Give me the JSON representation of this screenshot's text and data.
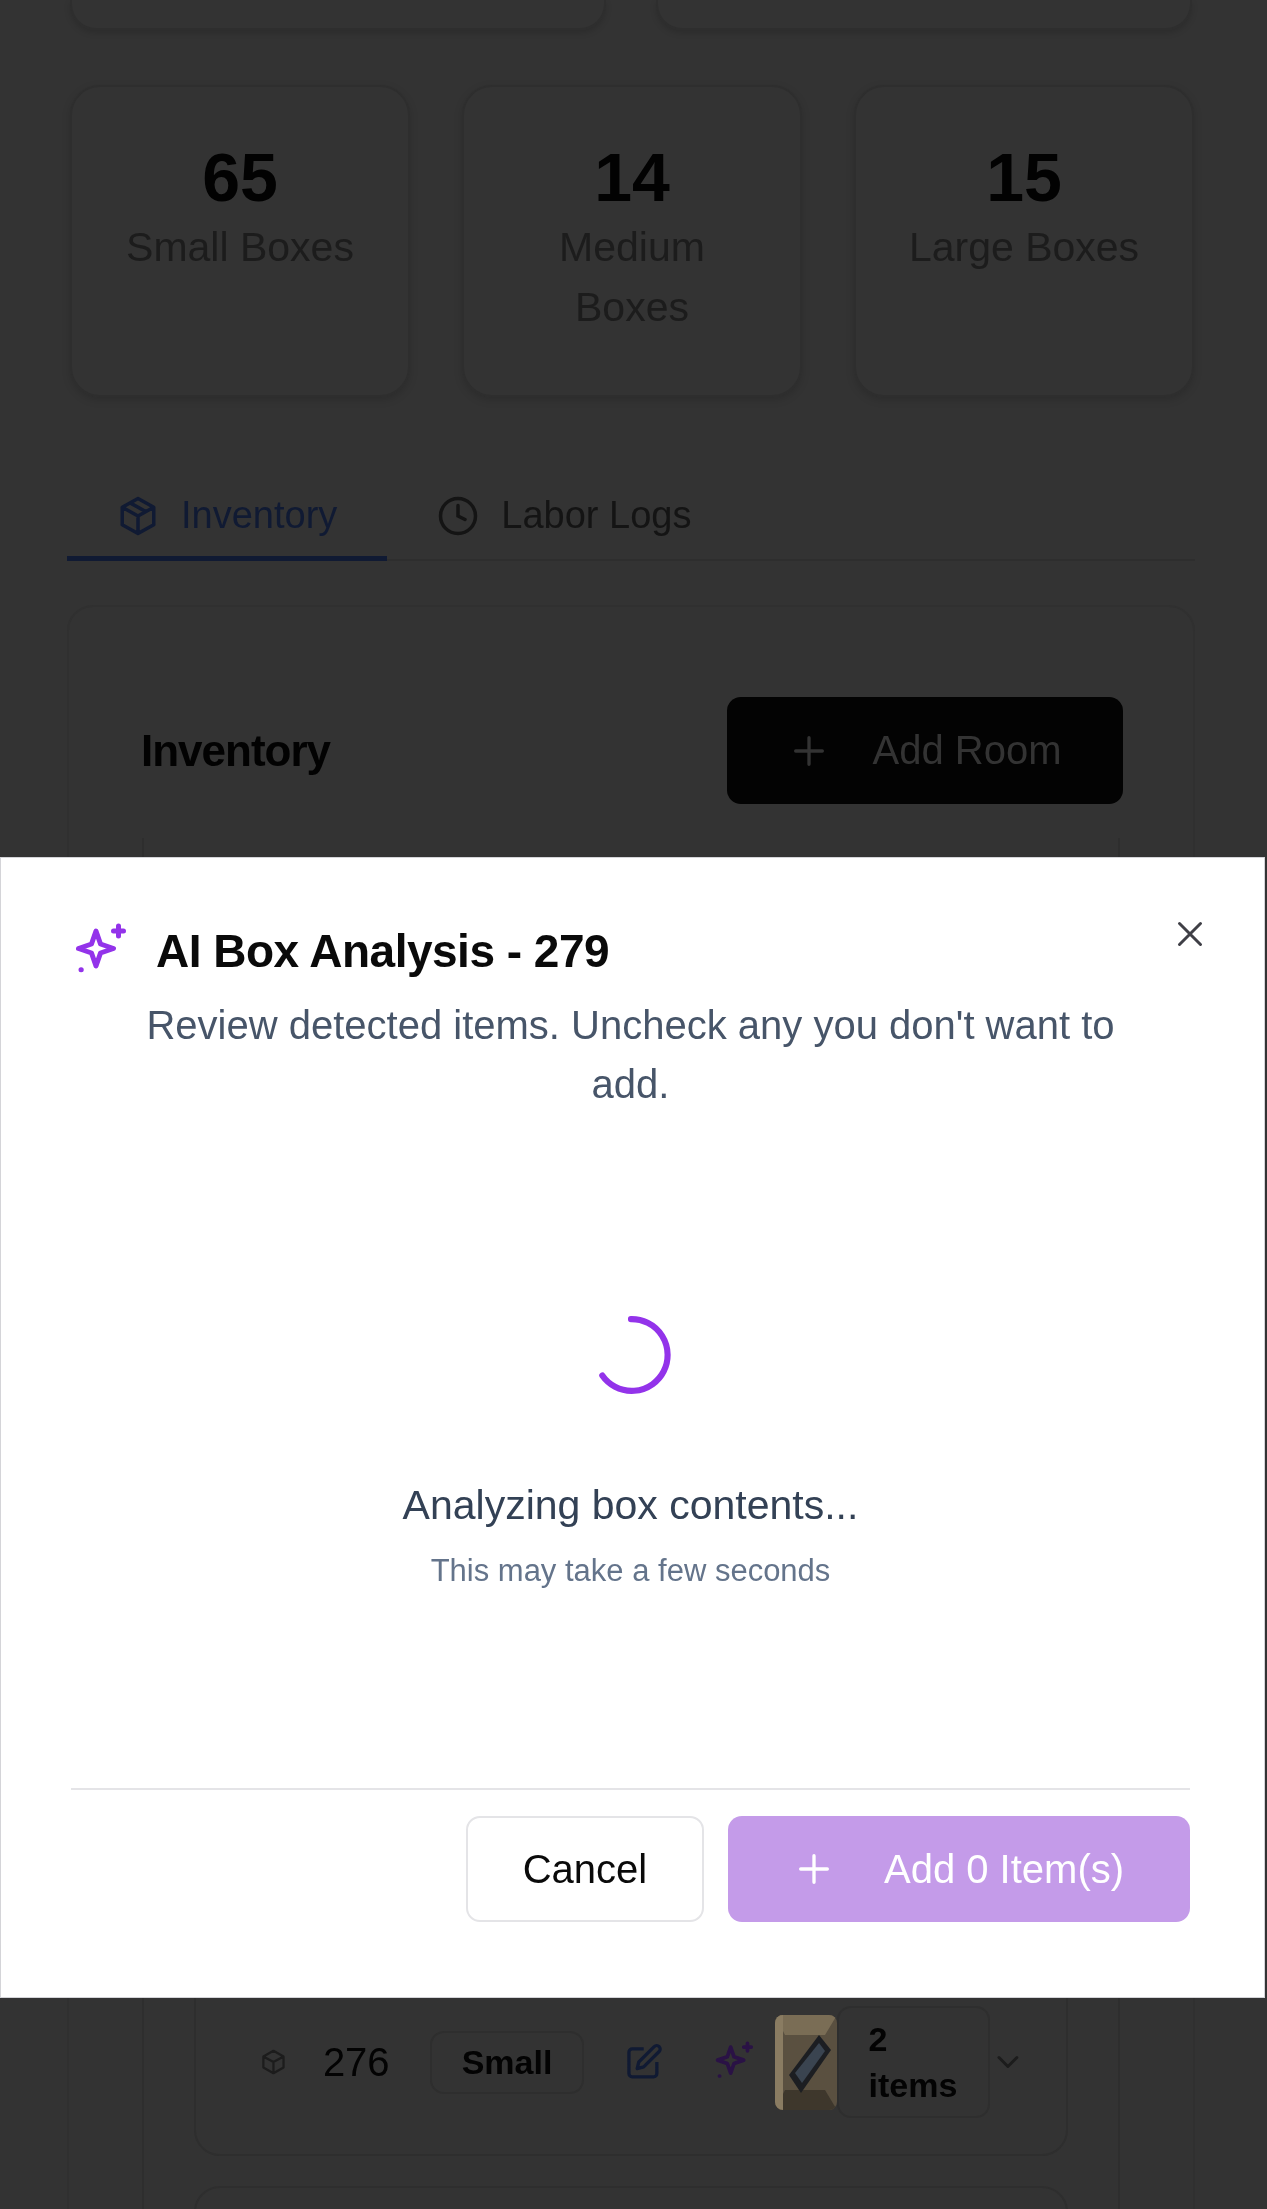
{
  "stats": [
    {
      "value": "65",
      "label": "Small Boxes"
    },
    {
      "value": "14",
      "label": "Medium Boxes"
    },
    {
      "value": "15",
      "label": "Large Boxes"
    }
  ],
  "tabs": [
    {
      "label": "Inventory",
      "selected": true
    },
    {
      "label": "Labor Logs",
      "selected": false
    }
  ],
  "inventory": {
    "title": "Inventory",
    "add_button": "Add Room"
  },
  "box_row": {
    "number": "276",
    "size": "Small",
    "item_count": "2 items",
    "expanded": false
  },
  "dialog": {
    "title": "AI Box Analysis - 279",
    "description": "Review detected items. Uncheck any you don't want to add.",
    "loading": {
      "message": "Analyzing box contents...",
      "hint": "This may take a few seconds"
    },
    "cancel": "Cancel",
    "confirm": {
      "label": "Add 0 Item(s)",
      "disabled": true
    }
  }
}
